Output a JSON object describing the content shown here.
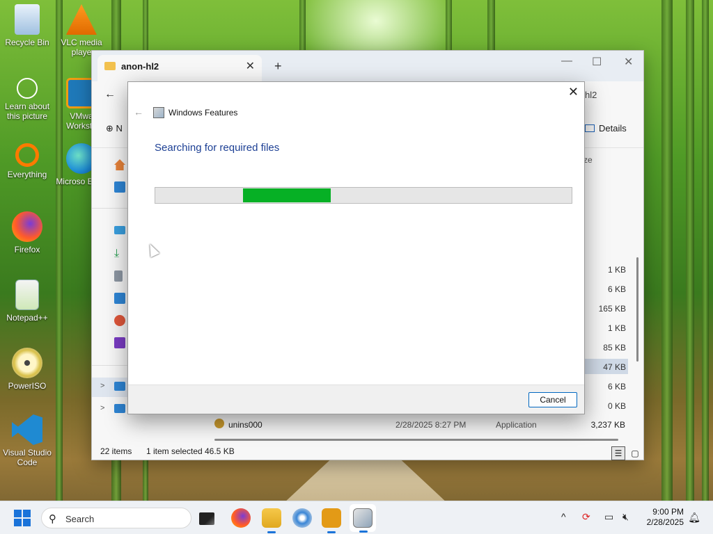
{
  "desktop": {
    "icons": [
      {
        "label": "Recycle Bin",
        "icon": "recycle-bin-icon"
      },
      {
        "label": "VLC media player",
        "icon": "vlc-icon"
      },
      {
        "label": "Learn about this picture",
        "icon": "learn-about-picture-icon"
      },
      {
        "label": "VMware Workstation",
        "icon": "vmware-icon"
      },
      {
        "label": "Everything",
        "icon": "everything-search-icon"
      },
      {
        "label": "Microsoft Edge",
        "icon": "edge-icon"
      },
      {
        "label": "Firefox",
        "icon": "firefox-icon"
      },
      {
        "label": "Notepad++",
        "icon": "notepad-plus-plus-icon"
      },
      {
        "label": "PowerISO",
        "icon": "poweriso-icon"
      },
      {
        "label": "Visual Studio Code",
        "icon": "vscode-icon"
      }
    ],
    "vlc_label_visible": "VLC media playe",
    "vmware_label_visible": "VMwa Worksta",
    "edge_label_visible": "Microso Edge"
  },
  "explorer": {
    "tab_title": "anon-hl2",
    "new_tab": "+",
    "path_fragment": "hl2",
    "new_label": "N",
    "details_label": "Details",
    "size_header": "ze",
    "sizes": [
      "1 KB",
      "6 KB",
      "165 KB",
      "1 KB",
      "85 KB",
      "47 KB",
      "6 KB",
      "0 KB",
      "3,237 KB"
    ],
    "selected_size_index": 5,
    "visible_file": {
      "name": "unins000",
      "date": "2/28/2025 8:27 PM",
      "type": "Application",
      "size": "3,237 KB"
    },
    "status": {
      "items": "22 items",
      "selected": "1 item selected",
      "selected_size": "46.5 KB"
    }
  },
  "dialog": {
    "app_title": "Windows Features",
    "heading": "Searching for required files",
    "cancel_label": "Cancel",
    "progress_indicator": {
      "start_fraction": 0.21,
      "end_fraction": 0.42,
      "color": "#06b025"
    }
  },
  "taskbar": {
    "search_placeholder": "Search",
    "apps": [
      "task-view-icon",
      "firefox-icon",
      "file-explorer-icon",
      "poweriso-icon",
      "half-life-icon",
      "windows-features-icon"
    ],
    "clock_time": "9:00 PM",
    "clock_date": "2/28/2025"
  },
  "colors": {
    "accent": "#1a73d9",
    "progress_green": "#06b025",
    "heading_blue": "#1c3f94"
  }
}
